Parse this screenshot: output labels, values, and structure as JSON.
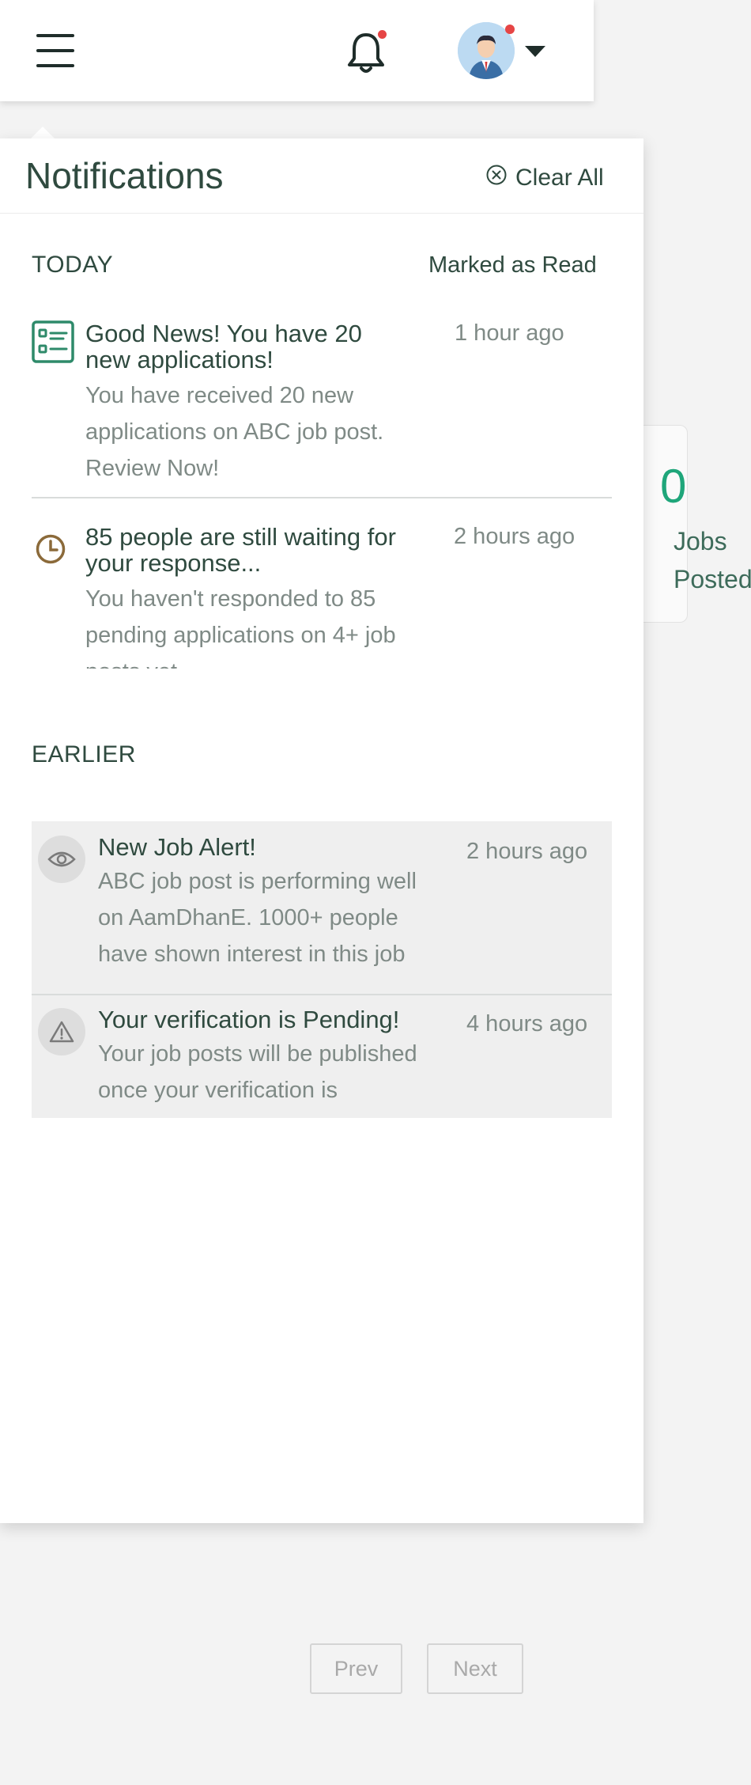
{
  "topbar": {
    "menu_icon": "hamburger-menu-icon",
    "bell_icon": "bell-icon",
    "avatar_icon": "user-avatar",
    "caret_icon": "caret-down-icon",
    "notification_dot_color": "#e64545"
  },
  "background": {
    "stat_value": "0",
    "stat_label_line1": "Jobs",
    "stat_label_line2": "Posted",
    "accent_color": "#1fa67a"
  },
  "panel": {
    "title": "Notifications",
    "clear_all_label": "Clear All",
    "clear_all_icon": "close-circle-icon",
    "today_label": "TODAY",
    "marked_read_label": "Marked as Read",
    "earlier_label": "EARLIER"
  },
  "today": [
    {
      "icon": "list-icon",
      "title_line1": "Good News! You have 20",
      "title_line2": "new applications!",
      "body_line1": "You have received 20 new",
      "body_line2": "applications on ABC job post.",
      "body_line3": "Review Now!",
      "time": "1 hour ago"
    },
    {
      "icon": "clock-icon",
      "title_line1": "85 people are still waiting for",
      "title_line2": "your response...",
      "body_line1": "You haven't responded to 85",
      "body_line2": "pending applications on 4+ job",
      "body_line3": "posts yet",
      "time": "2 hours ago"
    }
  ],
  "earlier": [
    {
      "icon": "eye-icon",
      "title": "New Job Alert!",
      "body_line1": "ABC job post is performing well",
      "body_line2": "on AamDhanE. 1000+ people",
      "body_line3": "have shown interest in this job",
      "time": "2 hours ago"
    },
    {
      "icon": "warning-icon",
      "title": "Your verification is Pending!",
      "body_line1": "Your job posts will be published",
      "body_line2": "once your verification is",
      "time": "4 hours ago"
    }
  ],
  "pagination": {
    "prev_label": "Prev",
    "next_label": "Next"
  }
}
